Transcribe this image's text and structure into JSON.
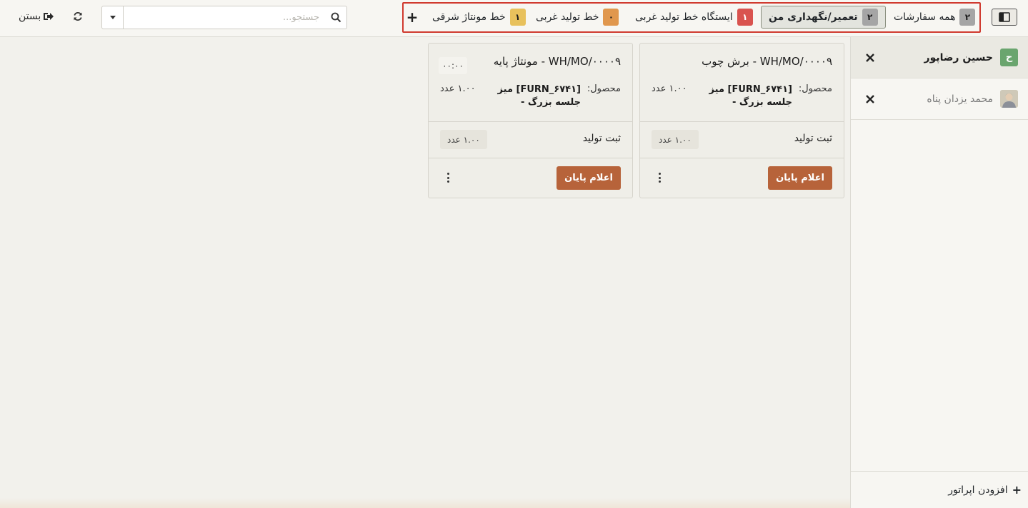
{
  "toolbar": {
    "close_label": "بستن",
    "search_placeholder": "جستجو..."
  },
  "workcenters": [
    {
      "label": "همه سفارشات",
      "count": "۲",
      "color": "#a5a5a5",
      "active": false
    },
    {
      "label": "تعمیر/نگهداری من",
      "count": "۲",
      "color": "#a5a5a5",
      "active": true
    },
    {
      "label": "ایستگاه خط تولید غربی",
      "count": "۱",
      "color": "#d9534f",
      "active": false
    },
    {
      "label": "خط تولید غربی",
      "count": "۰",
      "color": "#e0974d",
      "active": false
    },
    {
      "label": "خط مونتاژ شرقی",
      "count": "۱",
      "color": "#e8c15c",
      "active": false
    }
  ],
  "employees": [
    {
      "name": "حسین رضاپور",
      "initial": "ح",
      "avatar": "letter"
    },
    {
      "name": "محمد یزدان پناه",
      "avatar": "photo"
    }
  ],
  "add_operator_label": "افزودن اپراتور",
  "cards": [
    {
      "title": "WH/MO/۰۰۰۰۹ - برش چوب",
      "product_label": "محصول:",
      "product_name": "[FURN_۶۷۴۱] میز جلسه بزرگ -",
      "product_qty": "۱.۰۰ عدد",
      "step_label": "ثبت تولید",
      "step_qty": "۱.۰۰ عدد",
      "finish_label": "اعلام پایان"
    },
    {
      "title": "WH/MO/۰۰۰۰۹ - مونتاژ پایه",
      "timer": "۰۰:۰۰",
      "product_label": "محصول:",
      "product_name": "[FURN_۶۷۴۱] میز جلسه بزرگ -",
      "product_qty": "۱.۰۰ عدد",
      "step_label": "ثبت تولید",
      "step_qty": "۱.۰۰ عدد",
      "finish_label": "اعلام پایان"
    }
  ]
}
